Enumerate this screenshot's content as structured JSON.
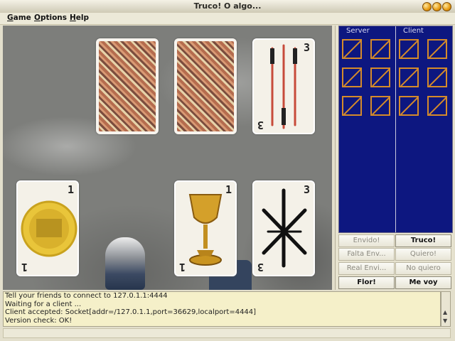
{
  "window": {
    "title": "Truco! O algo..."
  },
  "menu": {
    "game": "Game",
    "options": "Options",
    "help": "Help"
  },
  "table": {
    "opponent_cards": [
      {
        "face": "back"
      },
      {
        "face": "back"
      },
      {
        "face": "up",
        "number": "3",
        "suit": "sword"
      }
    ],
    "player_cards": [
      {
        "face": "up",
        "number": "1",
        "suit": "coin"
      },
      {
        "face": "up",
        "number": "1",
        "suit": "cup"
      },
      {
        "face": "up",
        "number": "3",
        "suit": "club"
      }
    ]
  },
  "scoreboard": {
    "server_label": "Server",
    "client_label": "Client",
    "server_score": 6,
    "client_score": 6
  },
  "buttons": {
    "envido": "Envido!",
    "truco": "Truco!",
    "falta_envido": "Falta Env...",
    "quiero": "Quiero!",
    "real_envido": "Real Envi...",
    "no_quiero": "No quiero",
    "flor": "Flor!",
    "me_voy": "Me voy"
  },
  "log": {
    "lines": [
      "Tell your friends to connect to 127.0.1.1:4444",
      "Waiting for a client ...",
      "Client accepted: Socket[addr=/127.0.1.1,port=36629,localport=4444]",
      "Version check: OK!"
    ]
  },
  "colors": {
    "scoreboard_bg": "#0d1780",
    "matchstick": "#d58b2a",
    "log_bg": "#f5f0c9"
  }
}
